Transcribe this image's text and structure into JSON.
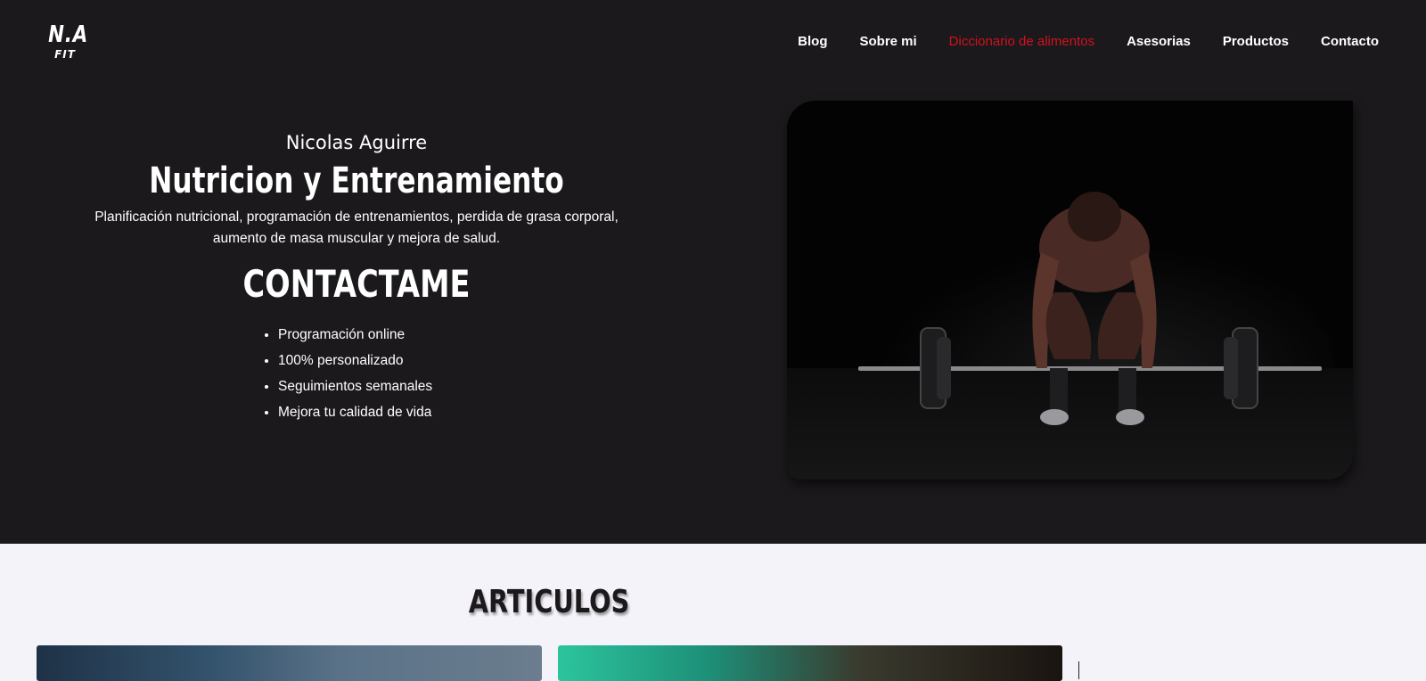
{
  "brand": {
    "logo_line1": "N.A",
    "logo_line2": "FIT"
  },
  "nav": {
    "items": [
      {
        "label": "Blog"
      },
      {
        "label": "Sobre mi"
      },
      {
        "label": "Diccionario de alimentos",
        "active": true
      },
      {
        "label": "Asesorias"
      },
      {
        "label": "Productos"
      },
      {
        "label": "Contacto"
      }
    ],
    "active_color": "#d0121f"
  },
  "hero": {
    "name": "Nicolas Aguirre",
    "title": "Nutricion y Entrenamiento",
    "description": "Planificación nutricional, programación de entrenamientos, perdida de grasa corporal, aumento de masa muscular y mejora de salud.",
    "cta": "CONTACTAME",
    "features": [
      "Programación online",
      "100% personalizado",
      "Seguimientos semanales",
      "Mejora tu calidad de vida"
    ],
    "background_color": "#1b191c"
  },
  "articles": {
    "title": "ARTICULOS"
  },
  "colors": {
    "page_background": "#f5f3fa",
    "accent": "#d0121f"
  }
}
